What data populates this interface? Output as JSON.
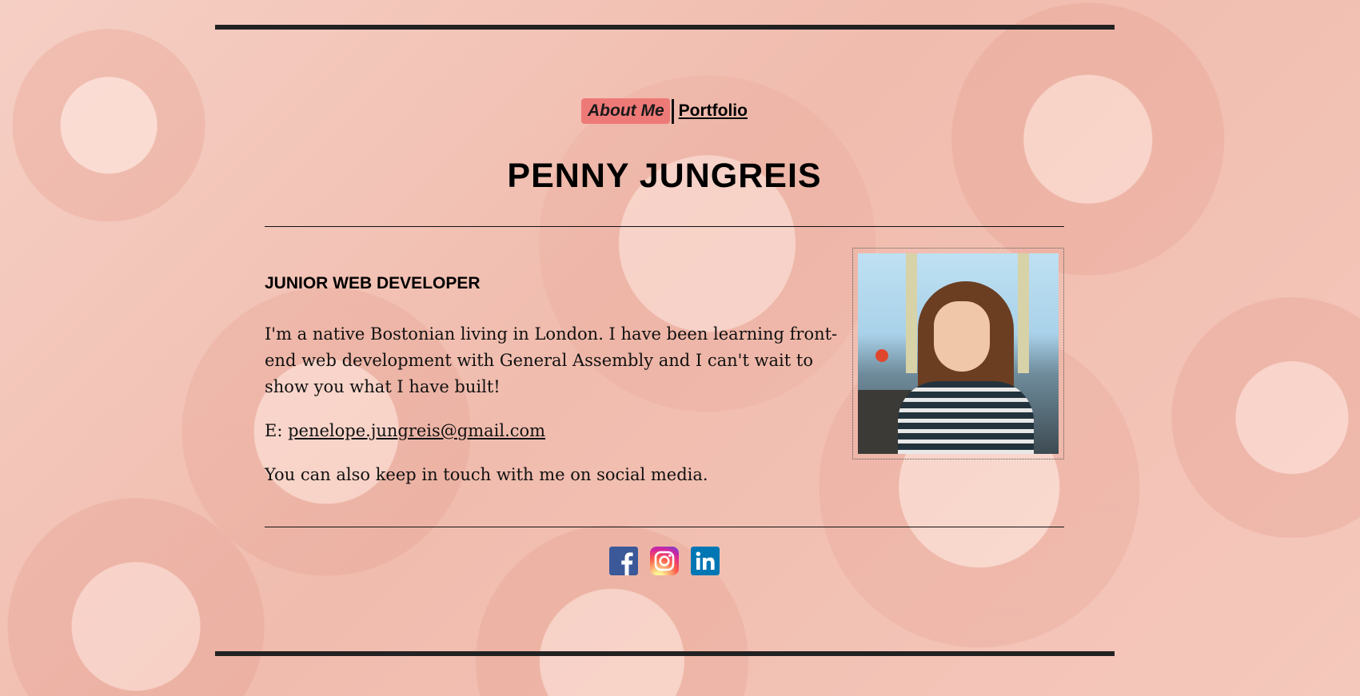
{
  "nav": {
    "about_label": "About Me",
    "portfolio_label": "Portfolio"
  },
  "header": {
    "name": "PENNY JUNGREIS"
  },
  "main": {
    "job_title": "JUNIOR WEB DEVELOPER",
    "bio": "I'm a native Bostonian living in London. I have been learning front-end web development with General Assembly and I can't wait to show you what I have built!",
    "email_prefix": "E: ",
    "email": "penelope.jungreis@gmail.com",
    "social_text": "You can also keep in touch with me on social media."
  },
  "social": [
    {
      "name": "facebook-icon",
      "color": "#3b5998"
    },
    {
      "name": "instagram-icon",
      "color": "#d6249f"
    },
    {
      "name": "linkedin-icon",
      "color": "#0077b5"
    }
  ],
  "colors": {
    "nav_active_bg": "#ee7a78",
    "frame_line": "#222222"
  }
}
